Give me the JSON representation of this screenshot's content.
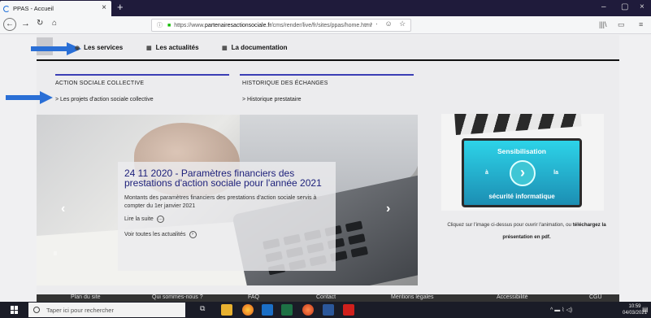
{
  "browser": {
    "tab_title": "PPAS - Accueil",
    "tab_close": "×",
    "new_tab": "+",
    "url_prefix": "https://www.",
    "url_host": "partenairesactionsociale.fr",
    "url_path": "/cms/render/live/fr/sites/ppas/home.html",
    "url_actions": "··· ☺ ☆",
    "window_controls": [
      "–",
      "▢",
      "×"
    ]
  },
  "menu": {
    "items": [
      {
        "label": "Les services"
      },
      {
        "label": "Les actualités"
      },
      {
        "label": "La documentation"
      }
    ]
  },
  "sections": [
    {
      "title": "ACTION SOCIALE COLLECTIVE",
      "link": "> Les projets d'action sociale collective"
    },
    {
      "title": "HISTORIQUE DES ÉCHANGES",
      "link": "> Historique prestataire"
    }
  ],
  "carousel": {
    "headline": "24 11 2020 - Paramètres financiers des prestations d'action sociale pour l'année 2021",
    "body": "Montants des paramètres financiers des prestations d'action sociale servis à compter du 1er janvier 2021",
    "read_more": "Lire la suite",
    "all_news": "Voir toutes les actualités",
    "pause_label": "II"
  },
  "promo": {
    "title": "Sensibilisation",
    "word_left": "à",
    "word_right": "la",
    "subtitle": "sécurité informatique",
    "caption_pre": "Cliquez sur l'image ci-dessus pour ouvrir l'animation, ou ",
    "caption_link": "téléchargez la présentation en pdf."
  },
  "footer": {
    "links": [
      "Plan du site",
      "Qui sommes-nous ?",
      "FAQ",
      "Contact",
      "Mentions légales",
      "Accessibilité",
      "CGU"
    ]
  },
  "taskbar": {
    "search_placeholder": "Taper ici pour rechercher",
    "time": "10:59",
    "date": "04/03/2021"
  },
  "colors": {
    "accent_blue": "#3b3fb5",
    "arrow_blue": "#2a6fd6",
    "headline_blue": "#1c1f7a"
  }
}
